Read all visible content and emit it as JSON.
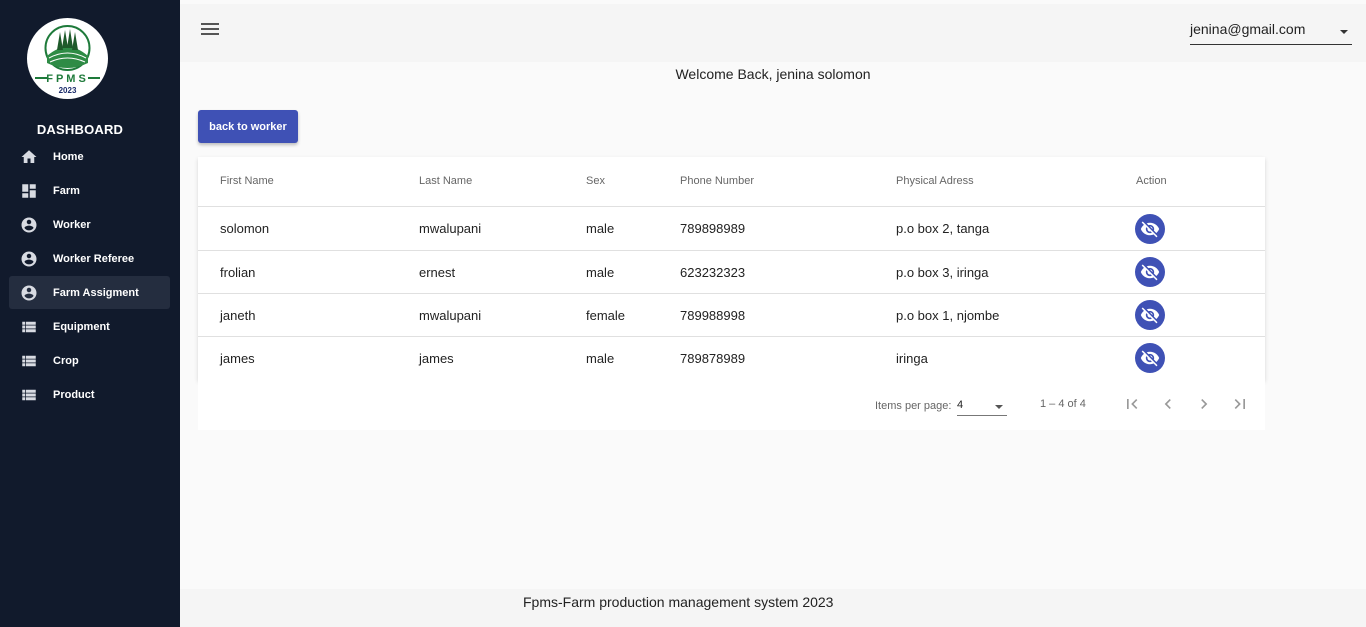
{
  "sidebar": {
    "logo_text": "FPMS",
    "logo_year": "2023",
    "title": "DASHBOARD",
    "items": [
      {
        "label": "Home",
        "icon": "home-icon"
      },
      {
        "label": "Farm",
        "icon": "dashboard-icon"
      },
      {
        "label": "Worker",
        "icon": "account-circle-icon"
      },
      {
        "label": "Worker Referee",
        "icon": "account-circle-icon"
      },
      {
        "label": "Farm Assigment",
        "icon": "account-circle-icon",
        "active": true
      },
      {
        "label": "Equipment",
        "icon": "list-icon"
      },
      {
        "label": "Crop",
        "icon": "list-icon"
      },
      {
        "label": "Product",
        "icon": "list-icon"
      }
    ]
  },
  "header": {
    "user_email": "jenina@gmail.com"
  },
  "welcome": "Welcome Back, jenina solomon",
  "back_button": "back to worker",
  "table": {
    "headers": [
      "First Name",
      "Last Name",
      "Sex",
      "Phone Number",
      "Physical Adress",
      "Action"
    ],
    "rows": [
      [
        "solomon",
        "mwalupani",
        "male",
        "789898989",
        "p.o box 2, tanga"
      ],
      [
        "frolian",
        "ernest",
        "male",
        "623232323",
        "p.o box 3, iringa"
      ],
      [
        "janeth",
        "mwalupani",
        "female",
        "789988998",
        "p.o box 1, njombe"
      ],
      [
        "james",
        "james",
        "male",
        "789878989",
        "iringa"
      ]
    ]
  },
  "paginator": {
    "items_per_page_label": "Items per page:",
    "items_per_page": "4",
    "range": "1 – 4 of 4"
  },
  "footer": "Fpms-Farm production management system 2023",
  "colors": {
    "sidebar_bg": "#111a2c",
    "primary": "#3f51b5",
    "page_bg": "#fafafa"
  }
}
